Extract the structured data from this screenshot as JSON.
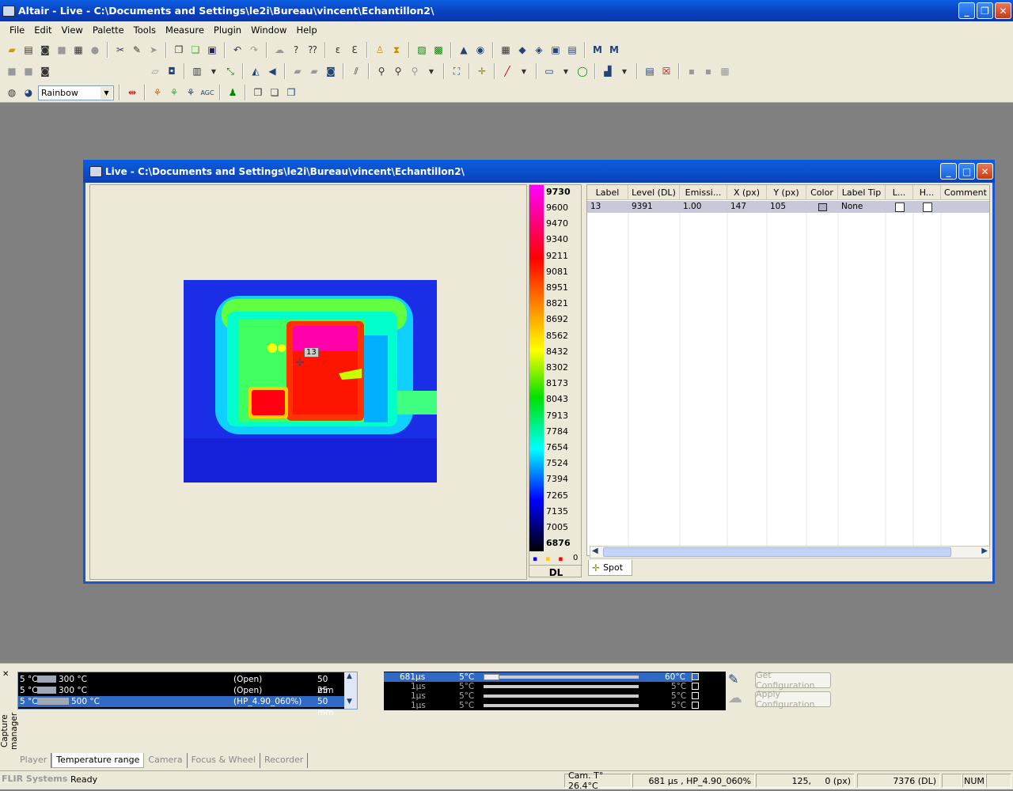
{
  "app": {
    "title": "Altair - Live - C:\\Documents and Settings\\le2i\\Bureau\\vincent\\Echantillon2\\"
  },
  "menu": [
    "File",
    "Edit",
    "View",
    "Palette",
    "Tools",
    "Measure",
    "Plugin",
    "Window",
    "Help"
  ],
  "toolbar": {
    "palette_value": "Rainbow"
  },
  "child": {
    "title": "Live - C:\\Documents and Settings\\le2i\\Bureau\\vincent\\Echantillon2\\",
    "spot_label": "13"
  },
  "colorbar": {
    "ticks": [
      "9730",
      "9600",
      "9470",
      "9340",
      "9211",
      "9081",
      "8951",
      "8821",
      "8692",
      "8562",
      "8432",
      "8302",
      "8173",
      "8043",
      "7913",
      "7784",
      "7654",
      "7524",
      "7394",
      "7265",
      "7135",
      "7005",
      "6876"
    ],
    "unit": "DL",
    "legend_count": "0"
  },
  "table": {
    "headers": [
      "Label",
      "Level (DL)",
      "Emissi...",
      "X (px)",
      "Y (px)",
      "Color",
      "Label Tip",
      "L...",
      "H...",
      "Comment"
    ],
    "row": [
      "13",
      "9391",
      "1.00",
      "147",
      "105",
      "",
      "None",
      "",
      "",
      ""
    ]
  },
  "spot_tab": "Spot",
  "capture": {
    "side_label": "Capture manager",
    "rows": [
      {
        "min": "5 °C",
        "max": "300 °C",
        "filter": "(Open)",
        "lens": "50 mm"
      },
      {
        "min": "5 °C",
        "max": "300 °C",
        "filter": "(Open)",
        "lens": "25 mm"
      },
      {
        "min": "5 °C",
        "max": "500 °C",
        "filter": "(HP_4.90_060%)",
        "lens": "50 mm"
      }
    ],
    "rates": [
      {
        "time": "681µs",
        "min": "5°C",
        "max": "60°C"
      },
      {
        "time": "1µs",
        "min": "5°C",
        "max": "5°C"
      },
      {
        "time": "1µs",
        "min": "5°C",
        "max": "5°C"
      },
      {
        "time": "1µs",
        "min": "5°C",
        "max": "5°C"
      }
    ],
    "get_cfg": "Get Configuration",
    "apply_cfg": "Apply Configuration",
    "tabs": [
      "Player",
      "Temperature range",
      "Camera",
      "Focus & Wheel",
      "Recorder"
    ]
  },
  "status": {
    "brand": "FLIR Systems",
    "state": "Ready",
    "cam_temp": "Cam. T° 26.4°C",
    "integration": "681 µs , HP_4.90_060%",
    "coords": "125,     0 (px)",
    "value": "7376 (DL)",
    "num": "NUM"
  }
}
